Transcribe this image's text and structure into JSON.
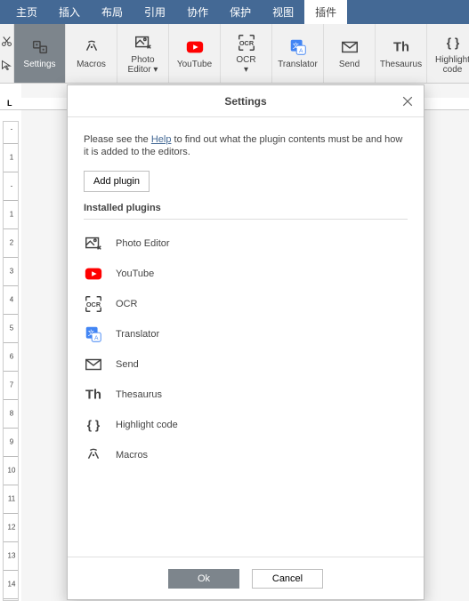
{
  "menu": {
    "tabs": [
      "主页",
      "插入",
      "布局",
      "引用",
      "协作",
      "保护",
      "视图",
      "插件"
    ],
    "active_index": 7
  },
  "ribbon": {
    "buttons": [
      {
        "id": "settings",
        "label": "Settings",
        "active": true
      },
      {
        "id": "macros",
        "label": "Macros"
      },
      {
        "id": "photo-editor",
        "label": "Photo Editor ▾"
      },
      {
        "id": "youtube",
        "label": "YouTube"
      },
      {
        "id": "ocr",
        "label": "OCR ▾"
      },
      {
        "id": "translator",
        "label": "Translator"
      },
      {
        "id": "send",
        "label": "Send"
      },
      {
        "id": "thesaurus",
        "label": "Thesaurus"
      },
      {
        "id": "highlight",
        "label": "Highlight code"
      }
    ]
  },
  "ruler": {
    "hmark": "L",
    "vnums": [
      "-",
      "1",
      "-",
      "1",
      "2",
      "3",
      "4",
      "5",
      "6",
      "7",
      "8",
      "9",
      "10",
      "11",
      "12",
      "13",
      "14"
    ]
  },
  "dialog": {
    "title": "Settings",
    "intro_pre": "Please see the ",
    "intro_link": "Help",
    "intro_post": " to find out what the plugin contents must be and how it is added to the editors.",
    "add_button": "Add plugin",
    "subhead": "Installed plugins",
    "plugins": [
      {
        "icon": "photo",
        "label": "Photo Editor"
      },
      {
        "icon": "youtube",
        "label": "YouTube"
      },
      {
        "icon": "ocr",
        "label": "OCR"
      },
      {
        "icon": "translator",
        "label": "Translator"
      },
      {
        "icon": "send",
        "label": "Send"
      },
      {
        "icon": "thesaurus",
        "label": "Thesaurus"
      },
      {
        "icon": "highlight",
        "label": "Highlight code"
      },
      {
        "icon": "macros",
        "label": "Macros"
      }
    ],
    "ok": "Ok",
    "cancel": "Cancel"
  }
}
